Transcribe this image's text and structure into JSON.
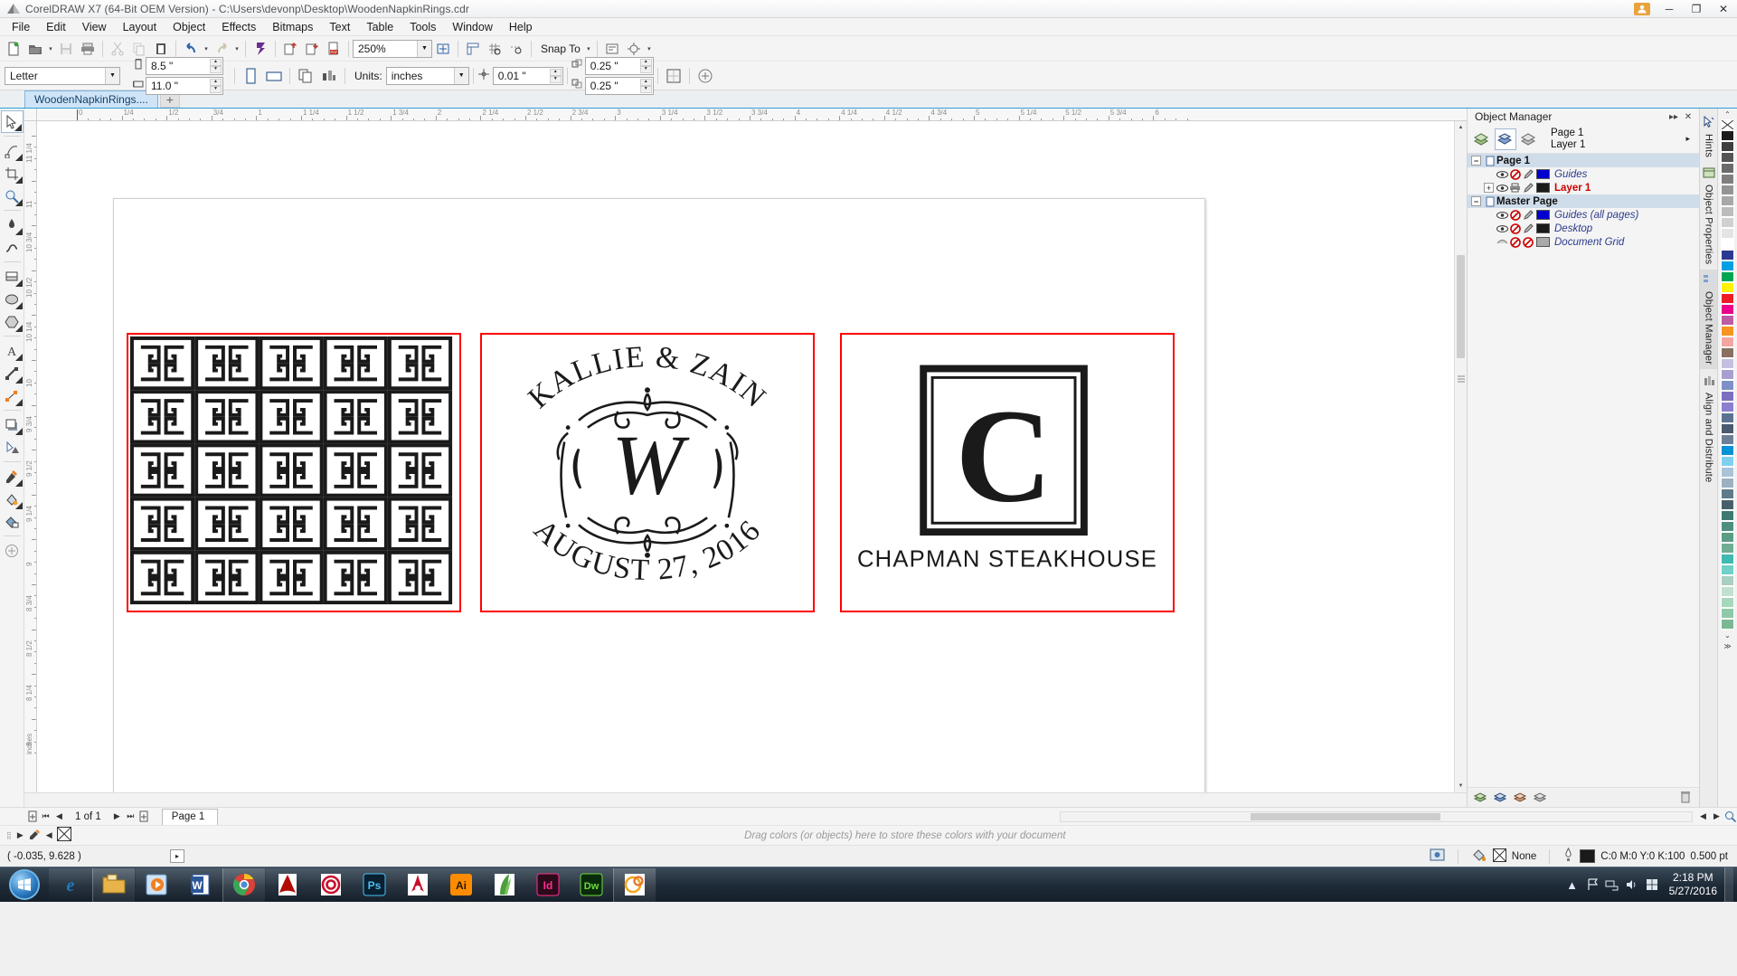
{
  "app": {
    "title": "CorelDRAW X7 (64-Bit OEM Version) - C:\\Users\\devonp\\Desktop\\WoodenNapkinRings.cdr",
    "window_buttons": {
      "minimize": "─",
      "maximize": "❐",
      "close": "✕"
    }
  },
  "menu": [
    {
      "label": "File"
    },
    {
      "label": "Edit"
    },
    {
      "label": "View"
    },
    {
      "label": "Layout"
    },
    {
      "label": "Object"
    },
    {
      "label": "Effects"
    },
    {
      "label": "Bitmaps"
    },
    {
      "label": "Text"
    },
    {
      "label": "Table"
    },
    {
      "label": "Tools"
    },
    {
      "label": "Window"
    },
    {
      "label": "Help"
    }
  ],
  "toolbar": {
    "zoom_level": "250%",
    "snap_to": "Snap To",
    "buttons": [
      "new-document-icon",
      "open-document-icon",
      "save-icon",
      "print-icon",
      "cut-icon",
      "copy-icon",
      "paste-icon",
      "undo-icon",
      "redo-icon",
      "corel-connect-icon",
      "import-icon",
      "export-icon",
      "publish-pdf-icon",
      "zoom-levels-icon",
      "full-screen-preview-icon",
      "show-rulers-icon",
      "show-grid-icon",
      "show-guides-icon",
      "options-icon"
    ]
  },
  "property_bar": {
    "paper_type": "Letter",
    "page_width": "8.5 \"",
    "page_height": "11.0 \"",
    "orientation_portrait": "portrait-icon",
    "orientation_landscape": "landscape-icon",
    "units_label": "Units:",
    "units_value": "inches",
    "nudge_value": "0.01 \"",
    "duplicate_x_label": "x",
    "duplicate_x": "0.25 \"",
    "duplicate_y_label": "y",
    "duplicate_y": "0.25 \""
  },
  "document_tab": {
    "name": "WoodenNapkinRings....",
    "add_label": "+"
  },
  "toolbox": [
    {
      "name": "pick-tool",
      "selected": true
    },
    {
      "name": "shape-tool",
      "selected": false
    },
    {
      "name": "crop-tool",
      "selected": false
    },
    {
      "name": "zoom-tool",
      "selected": false
    },
    {
      "name": "freehand-tool",
      "selected": false
    },
    {
      "name": "artistic-media-tool",
      "selected": false
    },
    {
      "name": "rectangle-tool",
      "selected": false
    },
    {
      "name": "ellipse-tool",
      "selected": false
    },
    {
      "name": "polygon-tool",
      "selected": false
    },
    {
      "name": "text-tool",
      "selected": false
    },
    {
      "name": "parallel-dimension-tool",
      "selected": false
    },
    {
      "name": "straight-line-connector-tool",
      "selected": false
    },
    {
      "name": "drop-shadow-tool",
      "selected": false
    },
    {
      "name": "transparency-tool",
      "selected": false
    },
    {
      "name": "color-eyedropper-tool",
      "selected": false
    },
    {
      "name": "interactive-fill-tool",
      "selected": false
    },
    {
      "name": "smart-fill-tool",
      "selected": false
    },
    {
      "name": "quick-customize-tool",
      "selected": false
    }
  ],
  "rulers": {
    "unit_corner": "inches",
    "unit_corner_v": "inches",
    "horizontal_labels": [
      "0",
      "1/4",
      "1/2",
      "3/4",
      "1",
      "1 1/4",
      "1 1/2",
      "1 3/4",
      "2",
      "2 1/4",
      "2 1/2",
      "2 3/4",
      "3",
      "3 1/4",
      "3 1/2",
      "3 3/4",
      "4",
      "4 1/4",
      "4 1/2",
      "4 3/4",
      "5",
      "5 1/4",
      "5 1/2",
      "5 3/4",
      "6"
    ],
    "vertical_labels": [
      "11 1/4",
      "11",
      "10 3/4",
      "10 1/2",
      "10 1/4",
      "10",
      "9 3/4",
      "9 1/2",
      "9 1/4",
      "9",
      "8 3/4",
      "8 1/2",
      "8 1/4",
      "8"
    ]
  },
  "artwork": {
    "cards": [
      {
        "name": "greek-key-pattern-card",
        "type": "pattern",
        "rows": 5,
        "cols": 5,
        "description": "Greek key meander tile pattern"
      },
      {
        "name": "wedding-monogram-card",
        "type": "monogram",
        "top_text": "KALLIE & ZAIN",
        "monogram_letter": "W",
        "bottom_text": "AUGUST 27, 2016"
      },
      {
        "name": "chapman-steakhouse-card",
        "type": "logo",
        "monogram_letter": "C",
        "caption": "CHAPMAN STEAKHOUSE"
      }
    ]
  },
  "docker": {
    "title": "Object Manager",
    "collapse_icon": "▸▸",
    "close_icon": "✕",
    "tool_buttons": [
      "show-object-properties-icon",
      "edit-across-layers-icon",
      "layer-manager-view-icon"
    ],
    "page_label_line1": "Page 1",
    "page_label_line2": "Layer 1",
    "expand_arrow": "▸",
    "rows": [
      {
        "label": "Page 1",
        "kind": "group",
        "expander": "−",
        "selected": true
      },
      {
        "label": "Guides",
        "kind": "layer",
        "color": "#0000d0",
        "style": "italic"
      },
      {
        "label": "Layer 1",
        "kind": "layer",
        "color": "#1a1a1a",
        "style": "red",
        "expander": "+"
      },
      {
        "label": "Master Page",
        "kind": "group",
        "expander": "−"
      },
      {
        "label": "Guides (all pages)",
        "kind": "layer",
        "color": "#0000d0",
        "style": "italic"
      },
      {
        "label": "Desktop",
        "kind": "layer",
        "color": "#1a1a1a",
        "style": "italic"
      },
      {
        "label": "Document Grid",
        "kind": "layer",
        "color": "#a9a9a9",
        "style": "italic"
      }
    ],
    "footer_buttons": [
      "new-layer-icon",
      "new-master-layer-icon",
      "new-master-layer-odd-icon",
      "new-master-layer-even-icon",
      "delete-icon"
    ],
    "tabs": [
      {
        "label": "Hints",
        "icon": "hints-icon",
        "active": false
      },
      {
        "label": "Object Properties",
        "icon": "object-properties-icon",
        "active": false
      },
      {
        "label": "Object Manager",
        "icon": "object-manager-icon",
        "active": true
      },
      {
        "label": "Align and Distribute",
        "icon": "align-distribute-icon",
        "active": false
      }
    ]
  },
  "palette": {
    "no_color_label": "X",
    "scroll_up": "⌃",
    "scroll_down": "⌄",
    "expand": "≫",
    "colors": [
      "#1c1c1c",
      "#3f3f3f",
      "#555555",
      "#6b6b6b",
      "#7f7f7f",
      "#949494",
      "#a8a8a8",
      "#bcbcbc",
      "#d0d0d0",
      "#e4e4e4",
      "#ffffff",
      "#2b3990",
      "#00a0e3",
      "#00a651",
      "#fff200",
      "#ed1c24",
      "#ec008c",
      "#bd5ca0",
      "#f7941e",
      "#f4a6a0",
      "#8a7060",
      "#c5c0e0",
      "#a89fd0",
      "#7f8fc9",
      "#7b6fc0",
      "#8a7fd0",
      "#5b7390",
      "#4a5a70",
      "#6b7f97",
      "#0093d6",
      "#7fd0f0",
      "#a8c4d8",
      "#9bb0c0",
      "#5f7a88",
      "#46606b",
      "#3f7a70",
      "#4f8f7f",
      "#5c9c84",
      "#6fae92",
      "#3fb9b1",
      "#6fd0c8",
      "#a8cfbf",
      "#c2e0cf",
      "#a6d8bb",
      "#8fc9a8",
      "#7ab894"
    ]
  },
  "page_bar": {
    "add_page_before": "add-page-before-icon",
    "first": "⏮",
    "prev": "◀",
    "counter": "1 of 1",
    "next": "▶",
    "last": "⏭",
    "add_page_after": "add-page-after-icon",
    "page_tab": "Page 1"
  },
  "color_bar": {
    "hint": "Drag colors (or objects) here to store these colors with your document"
  },
  "status_bar": {
    "coordinates": "( -0.035, 9.628 )",
    "expand_icon": "▸",
    "fill_label": "None",
    "outline_color": "C:0 M:0 Y:0 K:100",
    "outline_width": "0.500 pt",
    "outline_swatch": "#1a1a1a"
  },
  "taskbar": {
    "start": "start-orb-icon",
    "apps": [
      {
        "name": "internet-explorer",
        "glyph": "e",
        "color": "#1a7fc1",
        "pinned": true,
        "running": false
      },
      {
        "name": "windows-explorer",
        "glyph": "",
        "color": "#e8b44a",
        "pinned": true,
        "running": true
      },
      {
        "name": "windows-media-player",
        "glyph": "▶",
        "color": "#5a9fd4",
        "pinned": true,
        "running": false
      },
      {
        "name": "microsoft-word",
        "glyph": "W",
        "color": "#2b579a",
        "pinned": true,
        "running": false
      },
      {
        "name": "google-chrome",
        "glyph": "",
        "color": "#d94235",
        "pinned": true,
        "running": true
      },
      {
        "name": "adobe-acrobat",
        "glyph": "",
        "color": "#b30b00",
        "pinned": true,
        "running": false
      },
      {
        "name": "corel-painter",
        "glyph": "",
        "color": "#c8102e",
        "pinned": true,
        "running": false
      },
      {
        "name": "adobe-photoshop",
        "glyph": "Ps",
        "color": "#0a1f30",
        "pinned": true,
        "running": false
      },
      {
        "name": "adobe-indesign-red",
        "glyph": "",
        "color": "#c8102e",
        "pinned": true,
        "running": false
      },
      {
        "name": "adobe-illustrator",
        "glyph": "Ai",
        "color": "#ff8c00",
        "pinned": true,
        "running": false
      },
      {
        "name": "corel-paintshop",
        "glyph": "",
        "color": "#4a9e3f",
        "pinned": true,
        "running": false
      },
      {
        "name": "adobe-indesign",
        "glyph": "Id",
        "color": "#ff2d8e",
        "pinned": true,
        "running": false
      },
      {
        "name": "adobe-dreamweaver",
        "glyph": "Dw",
        "color": "#6fdc3f",
        "pinned": true,
        "running": false
      },
      {
        "name": "coreldraw",
        "glyph": "",
        "color": "#f5a623",
        "pinned": true,
        "running": true
      }
    ],
    "tray": [
      "show-hidden-icons",
      "action-center-flag-icon",
      "network-icon",
      "volume-icon",
      "windows-update-icon"
    ],
    "clock_time": "2:18 PM",
    "clock_date": "5/27/2016"
  }
}
